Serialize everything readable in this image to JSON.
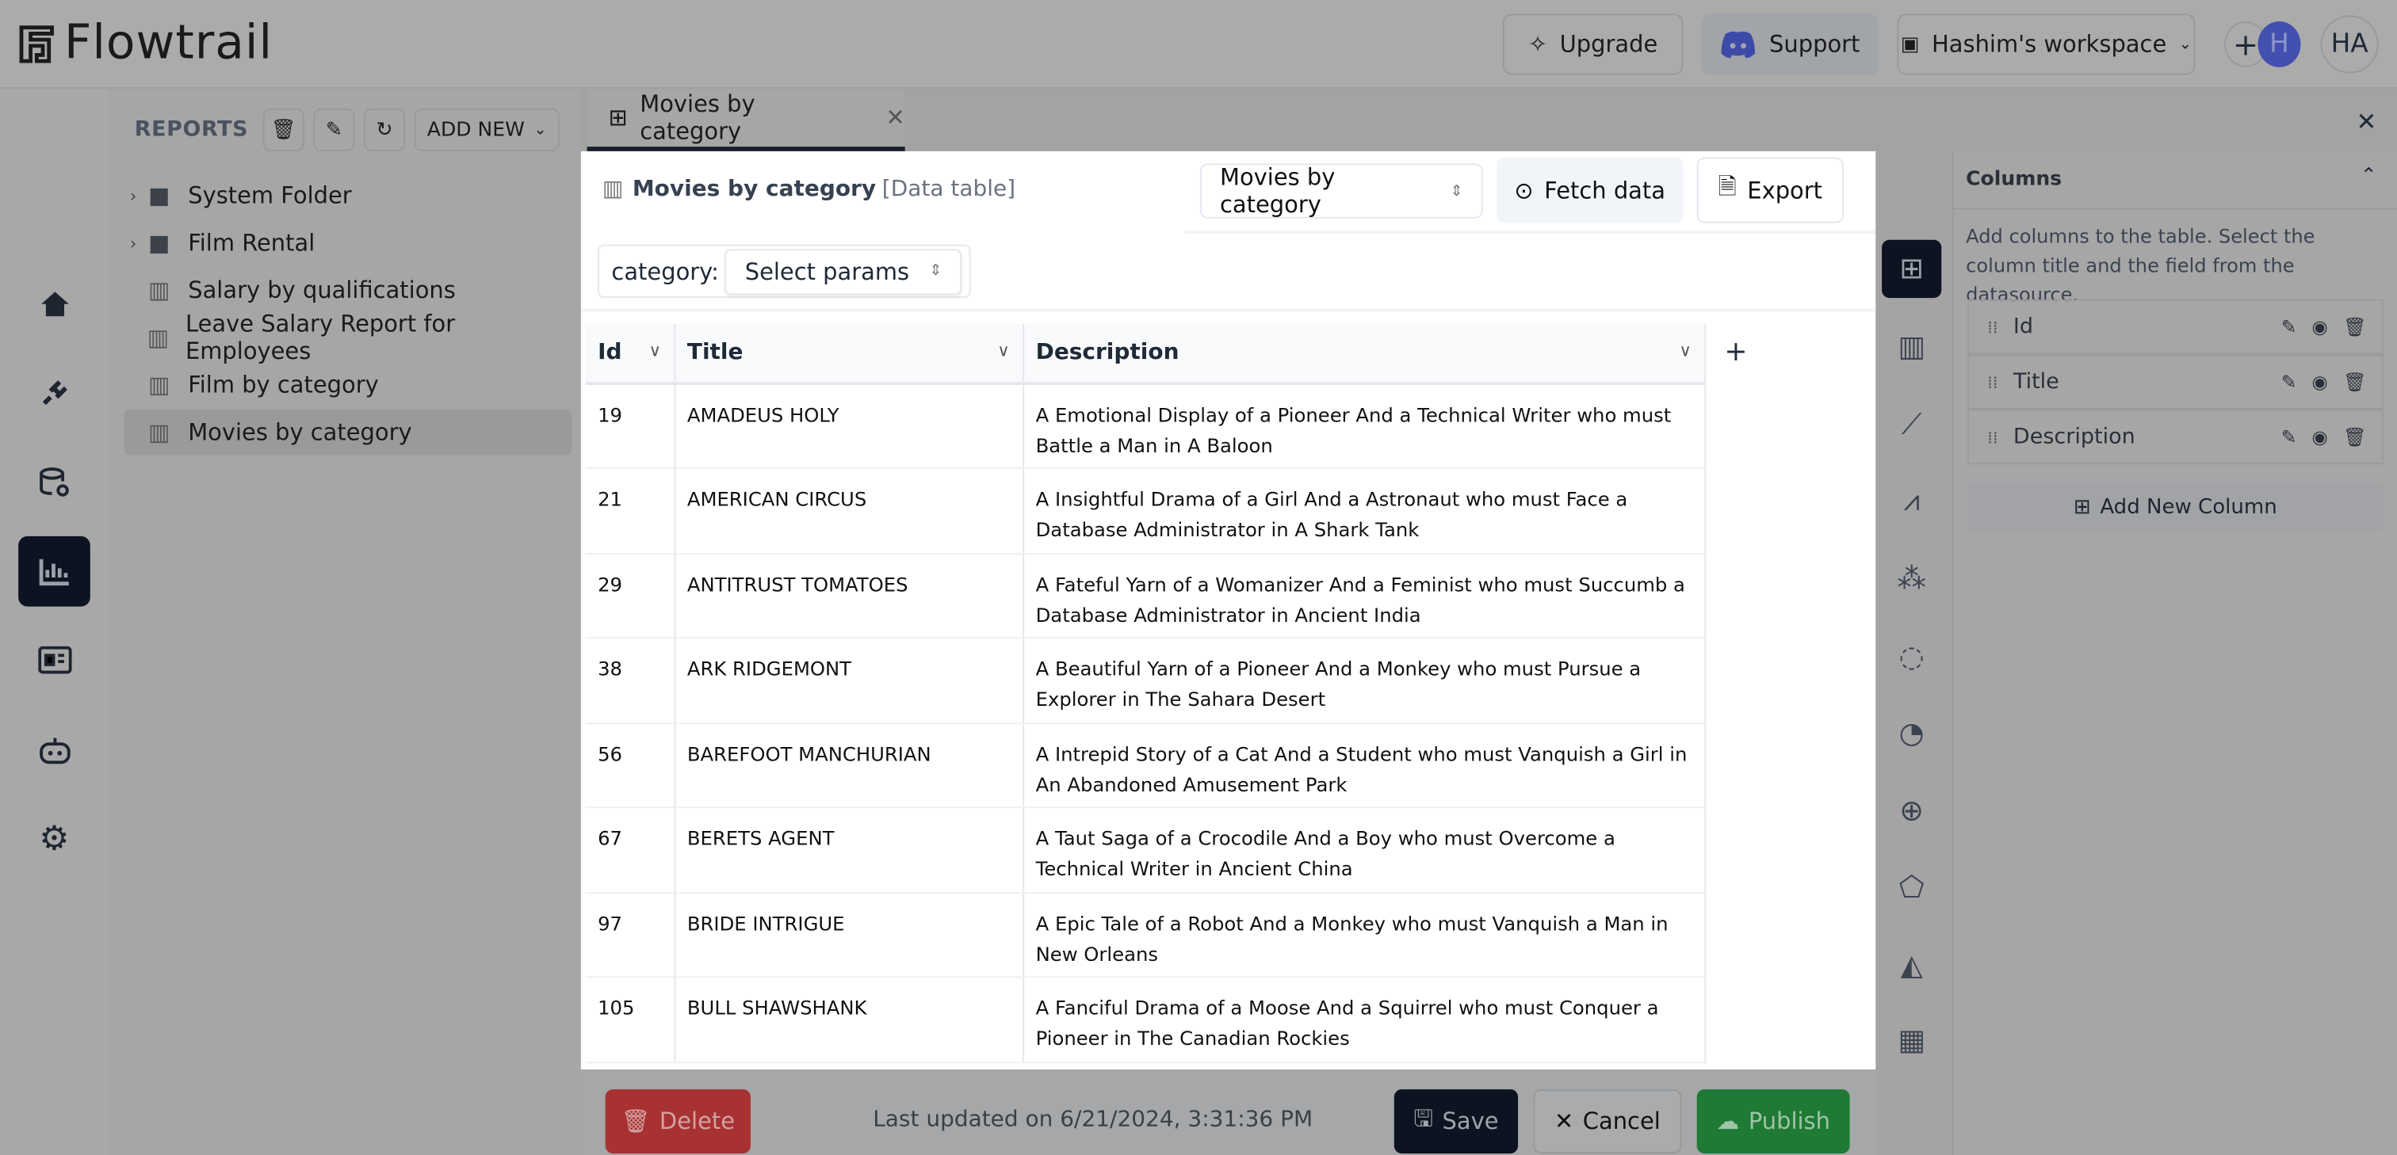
{
  "app": {
    "name": "Flowtrail"
  },
  "header": {
    "upgrade": "Upgrade",
    "support": "Support",
    "workspace": "Hashim's workspace",
    "avatar_small": "H",
    "avatar": "HA",
    "add_icon": "plus-icon"
  },
  "rail": {
    "items": [
      "home-icon",
      "plug-icon",
      "database-settings-icon",
      "reports-chart-icon",
      "dashboard-icon",
      "bot-icon",
      "gear-icon"
    ],
    "active": 3
  },
  "reports": {
    "title": "REPORTS",
    "add_new": "ADD NEW",
    "tree": [
      {
        "label": "System Folder",
        "type": "folder"
      },
      {
        "label": "Film Rental",
        "type": "folder"
      },
      {
        "label": "Salary by qualifications",
        "type": "report"
      },
      {
        "label": "Leave Salary Report for Employees",
        "type": "report"
      },
      {
        "label": "Film by category",
        "type": "report"
      },
      {
        "label": "Movies by category",
        "type": "report",
        "selected": true
      }
    ]
  },
  "tab": {
    "label": "Movies by category"
  },
  "editor": {
    "title": "Movies by category",
    "subtitle": "[Data table]",
    "report_select": "Movies by category",
    "fetch": "Fetch data",
    "export": "Export",
    "param_label": "category:",
    "param_placeholder": "Select params",
    "columns": [
      "Id",
      "Title",
      "Description"
    ],
    "rows": [
      [
        "19",
        "AMADEUS HOLY",
        "A Emotional Display of a Pioneer And a Technical Writer who must Battle a Man in A Baloon"
      ],
      [
        "21",
        "AMERICAN CIRCUS",
        "A Insightful Drama of a Girl And a Astronaut who must Face a Database Administrator in A Shark Tank"
      ],
      [
        "29",
        "ANTITRUST TOMATOES",
        "A Fateful Yarn of a Womanizer And a Feminist who must Succumb a Database Administrator in Ancient India"
      ],
      [
        "38",
        "ARK RIDGEMONT",
        "A Beautiful Yarn of a Pioneer And a Monkey who must Pursue a Explorer in The Sahara Desert"
      ],
      [
        "56",
        "BAREFOOT MANCHURIAN",
        "A Intrepid Story of a Cat And a Student who must Vanquish a Girl in An Abandoned Amusement Park"
      ],
      [
        "67",
        "BERETS AGENT",
        "A Taut Saga of a Crocodile And a Boy who must Overcome a Technical Writer in Ancient China"
      ],
      [
        "97",
        "BRIDE INTRIGUE",
        "A Epic Tale of a Robot And a Monkey who must Vanquish a Man in New Orleans"
      ],
      [
        "105",
        "BULL SHAWSHANK",
        "A Fanciful Drama of a Moose And a Squirrel who must Conquer a Pioneer in The Canadian Rockies"
      ]
    ]
  },
  "chart_types": [
    "table-icon",
    "bar-chart-icon",
    "line-chart-icon",
    "multi-line-chart-icon",
    "scatter-icon",
    "donut-icon",
    "pie-icon",
    "globe-icon",
    "radar-icon",
    "area-chart-icon",
    "dashboard-layout-icon"
  ],
  "columns_panel": {
    "title": "Columns",
    "help": "Add columns to the table. Select the column title and the field from the datasource.",
    "items": [
      "Id",
      "Title",
      "Description"
    ],
    "add": "Add New Column"
  },
  "footer": {
    "delete": "Delete",
    "updated": "Last updated on 6/21/2024, 3:31:36 PM",
    "save": "Save",
    "cancel": "Cancel",
    "publish": "Publish"
  },
  "colors": {
    "accent": "#0d1320",
    "delete": "#a83232",
    "publish": "#1e7a34",
    "avatar": "#4350b0"
  }
}
